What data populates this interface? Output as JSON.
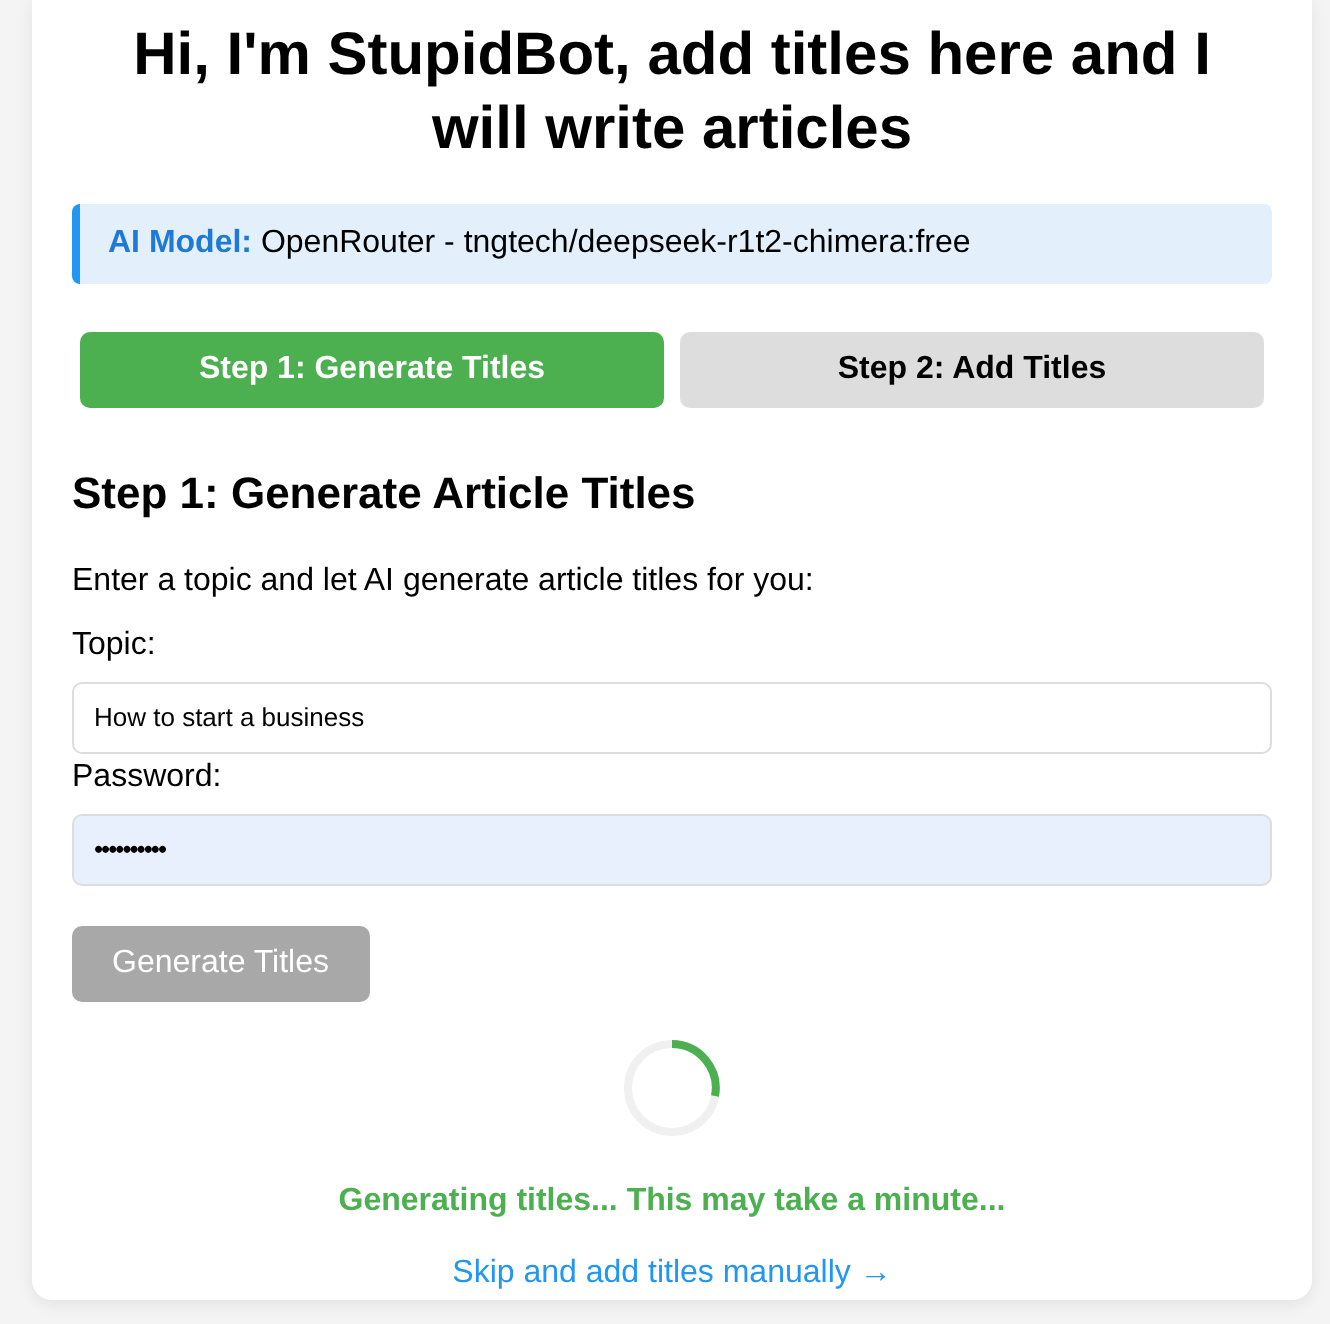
{
  "title": "Hi, I'm StupidBot, add titles here and I will write articles",
  "model_info": {
    "label": "AI Model:",
    "value": "OpenRouter - tngtech/deepseek-r1t2-chimera:free"
  },
  "steps": [
    {
      "label": "Step 1: Generate Titles",
      "selected": true
    },
    {
      "label": "Step 2: Add Titles",
      "selected": false
    }
  ],
  "section": {
    "heading": "Step 1: Generate Article Titles",
    "description": "Enter a topic and let AI generate article titles for you:"
  },
  "fields": [
    {
      "label": "Topic:",
      "kind": "text",
      "value": "How to start a business"
    },
    {
      "label": "Password:",
      "kind": "password",
      "value": "••••••••••"
    }
  ],
  "generate_button": {
    "label": "Generate Titles",
    "disabled": true
  },
  "loading": {
    "status": "Generating titles... This may take a minute...",
    "link": "Skip and add titles manually →"
  }
}
